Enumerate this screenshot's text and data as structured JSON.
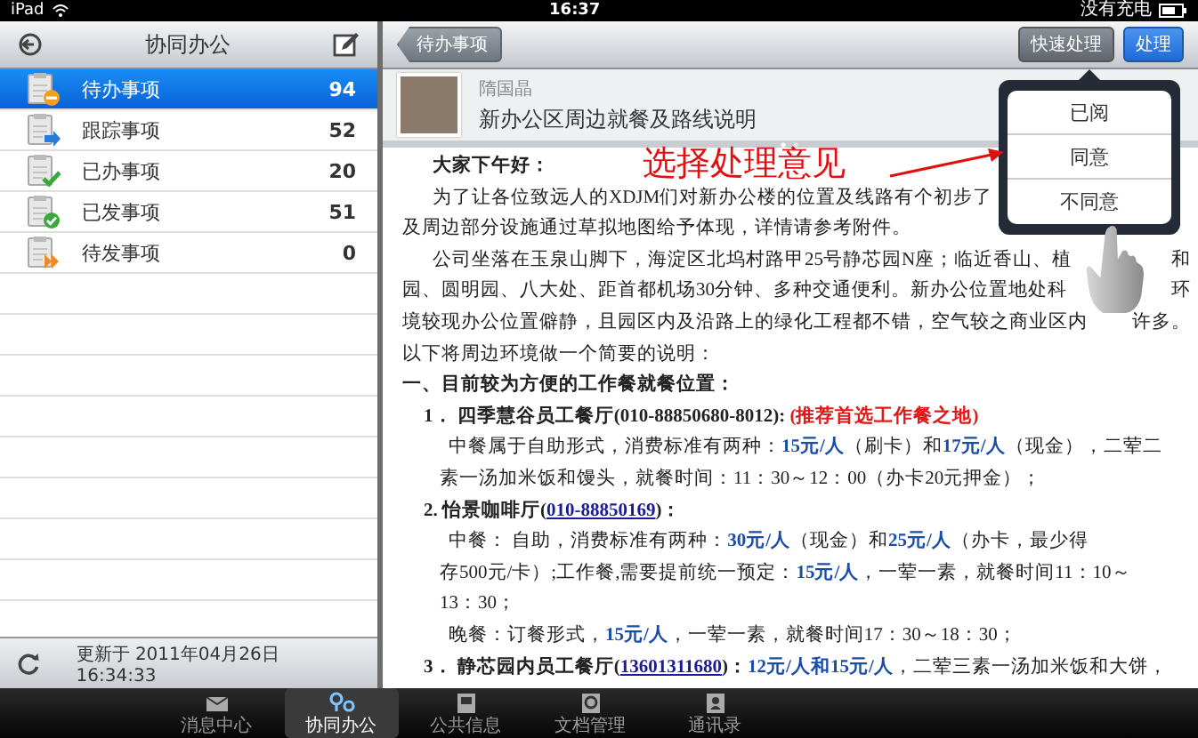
{
  "status_bar": {
    "device": "iPad",
    "time": "16:37",
    "charging": "没有充电"
  },
  "sidebar": {
    "title": "协同办公",
    "items": [
      {
        "label": "待办事项",
        "count": "94",
        "selected": true,
        "kind": "pending"
      },
      {
        "label": "跟踪事项",
        "count": "52",
        "selected": false,
        "kind": "tracking"
      },
      {
        "label": "已办事项",
        "count": "20",
        "selected": false,
        "kind": "done"
      },
      {
        "label": "已发事项",
        "count": "51",
        "selected": false,
        "kind": "sent"
      },
      {
        "label": "待发事项",
        "count": "0",
        "selected": false,
        "kind": "unsent"
      }
    ],
    "updated": "更新于 2011年04月26日 16:34:33"
  },
  "toolbar": {
    "back": "待办事项",
    "buttons": [
      {
        "label": "快速处理",
        "kind": "dark"
      },
      {
        "label": "处理",
        "kind": "primary"
      }
    ]
  },
  "message": {
    "sender": "隋国晶",
    "subject": "新办公区周边就餐及路线说明",
    "lines": [
      {
        "kind": "para",
        "segments": [
          {
            "text": "大家下午好：",
            "kind": "bold"
          }
        ]
      },
      {
        "kind": "para",
        "segments": [
          {
            "text": "为了让各位致远人的XDJM们对新办公楼的位置及线路有个初步了",
            "kind": "plain"
          }
        ]
      },
      {
        "kind": "flush",
        "segments": [
          {
            "text": "及周边部分设施通过草拟地图给予体现，详情请参考附件。",
            "kind": "plain"
          }
        ]
      },
      {
        "kind": "para",
        "segments": [
          {
            "text": "公司坐落在玉泉山脚下，海淀区北坞村路甲25号静芯园N座；临近香山、植",
            "kind": "plain"
          }
        ],
        "after": "和"
      },
      {
        "kind": "flush",
        "segments": [
          {
            "text": "园、圆明园、八大处、距首都机场30分钟、多种交通便利。新办公位置地处科",
            "kind": "plain"
          }
        ],
        "after": "环"
      },
      {
        "kind": "flush",
        "segments": [
          {
            "text": "境较现办公位置僻静，且园区内及沿路上的绿化工程都不错，空气较之商业区内",
            "kind": "plain"
          }
        ],
        "after": "许多。"
      },
      {
        "kind": "flush",
        "segments": [
          {
            "text": "以下将周边环境做一个简要的说明：",
            "kind": "plain"
          }
        ]
      },
      {
        "kind": "flush",
        "segments": [
          {
            "text": "一、目前较为方便的工作餐就餐位置：",
            "kind": "bold"
          }
        ]
      },
      {
        "kind": "list",
        "segments": [
          {
            "text": "1．  四季慧谷员工餐厅(010-88850680-8012):",
            "kind": "bold"
          },
          {
            "text": " (推荐首选工作餐之地)",
            "kind": "red"
          }
        ]
      },
      {
        "kind": "detail",
        "segments": [
          {
            "text": "中餐属于自助形式，消费标准有两种：",
            "kind": "plain"
          },
          {
            "text": "15元/人",
            "kind": "blue"
          },
          {
            "text": "（刷卡）和",
            "kind": "plain"
          },
          {
            "text": "17元/人",
            "kind": "blue"
          },
          {
            "text": "（现金），二荤二",
            "kind": "plain"
          }
        ]
      },
      {
        "kind": "cont",
        "segments": [
          {
            "text": "素一汤加米饭和馒头，就餐时间：11：30～12：00（办卡20元押金）；",
            "kind": "plain"
          }
        ]
      },
      {
        "kind": "list",
        "segments": [
          {
            "text": "2. 怡景咖啡厅(",
            "kind": "bold"
          },
          {
            "text": "010-88850169",
            "kind": "link"
          },
          {
            "text": ")：",
            "kind": "bold"
          }
        ]
      },
      {
        "kind": "detail",
        "segments": [
          {
            "text": "中餐：  自助，消费标准有两种：",
            "kind": "plain"
          },
          {
            "text": "30元/人",
            "kind": "blue"
          },
          {
            "text": "（现金）和",
            "kind": "plain"
          },
          {
            "text": "25元/人",
            "kind": "blue"
          },
          {
            "text": "（办卡，最少得",
            "kind": "plain"
          }
        ]
      },
      {
        "kind": "cont",
        "segments": [
          {
            "text": "存500元/卡）;工作餐,需要提前统一预定：",
            "kind": "plain"
          },
          {
            "text": "15元/人",
            "kind": "blue"
          },
          {
            "text": "，一荤一素，就餐时间11：10～",
            "kind": "plain"
          }
        ]
      },
      {
        "kind": "cont",
        "segments": [
          {
            "text": "13：30；",
            "kind": "plain"
          }
        ]
      },
      {
        "kind": "detail",
        "segments": [
          {
            "text": "晚餐：订餐形式，",
            "kind": "plain"
          },
          {
            "text": "15元/人",
            "kind": "blue"
          },
          {
            "text": "，一荤一素，就餐时间17：30～18：30；",
            "kind": "plain"
          }
        ]
      },
      {
        "kind": "list",
        "segments": [
          {
            "text": "3．  静芯园内员工餐厅(",
            "kind": "bold"
          },
          {
            "text": "13601311680",
            "kind": "link"
          },
          {
            "text": ")：",
            "kind": "bold"
          },
          {
            "text": "12元/人和15元/人",
            "kind": "blue"
          },
          {
            "text": "，二荤三素一汤加米饭和大饼，",
            "kind": "plain"
          }
        ]
      }
    ]
  },
  "popover": {
    "options": [
      "已阅",
      "同意",
      "不同意"
    ]
  },
  "annotation": {
    "text": "选择处理意见"
  },
  "tab_bar": [
    {
      "label": "消息中心",
      "selected": false
    },
    {
      "label": "协同办公",
      "selected": true
    },
    {
      "label": "公共信息",
      "selected": false
    },
    {
      "label": "文档管理",
      "selected": false
    },
    {
      "label": "通讯录",
      "selected": false
    }
  ]
}
